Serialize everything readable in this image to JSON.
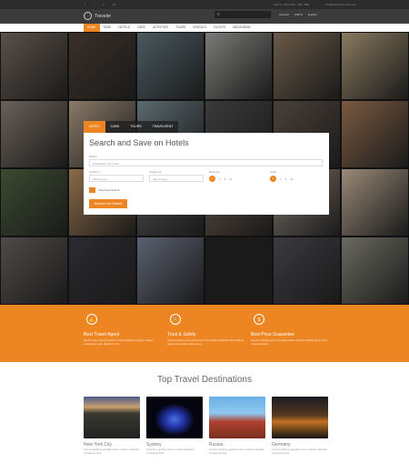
{
  "topbar": {
    "social": [
      "f",
      "t",
      "in",
      "G+"
    ],
    "contact": "Call us: (000) 999 - 656 - 888",
    "email": "info@travelerthemes.com"
  },
  "header": {
    "logo": "Traveler",
    "search_placeholder": "",
    "account": "Account",
    "currency": "USD $",
    "language": "English"
  },
  "nav": [
    "HOME",
    "PAGE",
    "HOTELS",
    "CARS",
    "ACTIVITIES",
    "TOURS",
    "RENTALS",
    "FLIGHTS",
    "MEGA MENU"
  ],
  "search_panel": {
    "tabs": [
      "HOTEL",
      "CARS",
      "TOURS",
      "TRAVELRENT"
    ],
    "title": "Search and Save on Hotels",
    "where_label": "Where",
    "where_placeholder": "Destination,City Code",
    "checkin_label": "Check in",
    "checkin_placeholder": "dd/mm/yyyy",
    "checkout_label": "Check out",
    "checkout_placeholder": "dd/mm/yyyy",
    "rooms_label": "Room(s)",
    "rooms": [
      "1",
      "2",
      "3",
      "3+"
    ],
    "adult_label": "Adult",
    "adults": [
      "1",
      "2",
      "3",
      "3+"
    ],
    "advanced": "Advanced Search",
    "submit": "Search for Hotels"
  },
  "features": [
    {
      "icon": "thumbs-up",
      "title": "Best Travel Agent",
      "text": "Morbi tempor fames lobortis ac hac penatibus quisque massa scelerisque proin dignissim nisl"
    },
    {
      "icon": "lock",
      "title": "Trust & Safety",
      "text": "Viverra magna sociis accumsan enim integer faucibus nibh tincidunt platea consectetur etiam amet"
    },
    {
      "icon": "dollar",
      "title": "Best Price Guarantee",
      "text": "Aenean volutpat enim venenatis platea molestie lobortis purus nunc tempor placerat"
    }
  ],
  "destinations": {
    "title": "Top Travel Destinations",
    "items": [
      {
        "name": "New York City",
        "text": "Cursus faucibus egestas rutrum mauris vulputate consequat ante"
      },
      {
        "name": "Sydney",
        "text": "Faucibus egestas rutrum mauris vulputate consequat ante"
      },
      {
        "name": "Russia",
        "text": "Cursus faucibus egestas rutrum mauris vulputate consequat ante"
      },
      {
        "name": "Germany",
        "text": "Cursus faucibus egestas rutrum mauris vulputate consequat ante"
      }
    ]
  },
  "colors": {
    "accent": "#ee8523"
  }
}
